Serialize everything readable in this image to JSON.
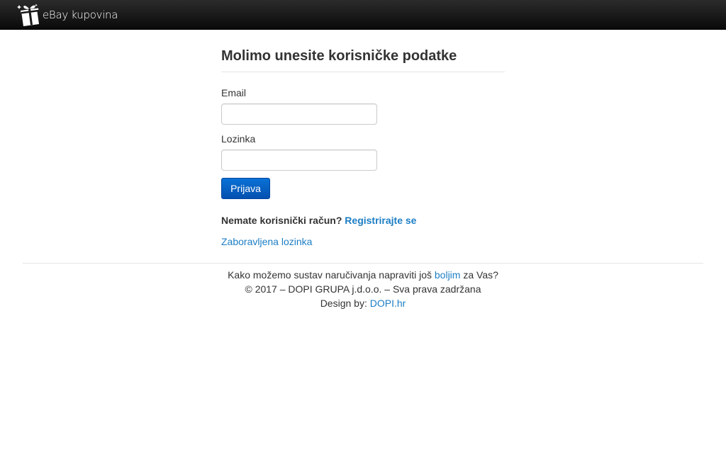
{
  "navbar": {
    "brand": "eBay kupovina"
  },
  "login": {
    "title": "Molimo unesite korisničke podatke",
    "email_label": "Email",
    "email_value": "",
    "password_label": "Lozinka",
    "password_value": "",
    "submit_label": "Prijava",
    "register_prompt": "Nemate korisnički račun?",
    "register_link": "Registrirajte se",
    "forgot_link": "Zaboravljena lozinka"
  },
  "footer": {
    "feedback_before": "Kako možemo sustav naručivanja napraviti još",
    "feedback_link": "boljim",
    "feedback_after": "za Vas?",
    "copyright": "© 2017 – DOPI GRUPA j.d.o.o. – Sva prava zadržana",
    "design_label": "Design by:",
    "design_link": "DOPI.hr"
  },
  "colors": {
    "accent_link": "#1c7ec4",
    "button": "#0450b0",
    "navbar": "#1a1a1a"
  },
  "icons": {
    "brand": "gift-box-icon"
  }
}
